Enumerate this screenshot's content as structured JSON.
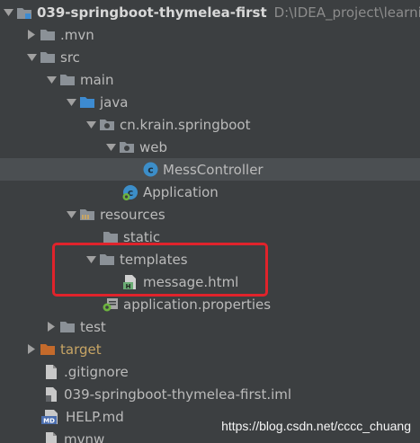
{
  "tree": {
    "project": {
      "name": "039-springboot-thymelea-first",
      "path": "D:\\IDEA_project\\learning"
    },
    "items": [
      {
        "label": ".mvn",
        "icon": "folder-icon"
      },
      {
        "label": "src",
        "icon": "folder-icon"
      },
      {
        "label": "main",
        "icon": "folder-icon"
      },
      {
        "label": "java",
        "icon": "source-root-folder-icon"
      },
      {
        "label": "cn.krain.springboot",
        "icon": "package-icon"
      },
      {
        "label": "web",
        "icon": "package-icon"
      },
      {
        "label": "MessController",
        "icon": "java-class-icon"
      },
      {
        "label": "Application",
        "icon": "spring-boot-class-icon"
      },
      {
        "label": "resources",
        "icon": "resources-folder-icon"
      },
      {
        "label": "static",
        "icon": "folder-icon"
      },
      {
        "label": "templates",
        "icon": "folder-icon"
      },
      {
        "label": "message.html",
        "icon": "html-file-icon"
      },
      {
        "label": "application.properties",
        "icon": "spring-properties-icon"
      },
      {
        "label": "test",
        "icon": "folder-icon"
      },
      {
        "label": "target",
        "icon": "excluded-folder-icon"
      },
      {
        "label": ".gitignore",
        "icon": "text-file-icon"
      },
      {
        "label": "039-springboot-thymelea-first.iml",
        "icon": "iml-file-icon"
      },
      {
        "label": "HELP.md",
        "icon": "markdown-file-icon"
      },
      {
        "label": "mvnw",
        "icon": "text-file-icon"
      }
    ]
  },
  "watermark": "https://blog.csdn.net/cccc_chuang",
  "colors": {
    "background": "#3c3f41",
    "selected_row": "#4b4f52",
    "highlight_box": "#e0232b",
    "excluded": "#c7a565"
  }
}
